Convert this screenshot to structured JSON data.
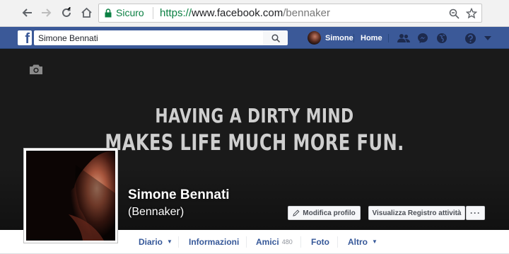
{
  "browser": {
    "secure_label": "Sicuro",
    "url_scheme": "https://",
    "url_host": "www.facebook.com",
    "url_path": "/bennaker"
  },
  "fb_bar": {
    "logo": "f",
    "search_value": "Simone Bennati",
    "user_name": "Simone",
    "home_label": "Home"
  },
  "cover": {
    "quote_line1": "HAVING A DIRTY MIND",
    "quote_line2": "MAKES LIFE MUCH MORE FUN."
  },
  "profile": {
    "name": "Simone Bennati",
    "alternate_name": "(Bennaker)"
  },
  "actions": {
    "edit_profile": "Modifica profilo",
    "activity_log": "Visualizza Registro attività",
    "more": "···"
  },
  "tabs": {
    "timeline": "Diario",
    "about": "Informazioni",
    "friends": "Amici",
    "friends_count": "480",
    "photos": "Foto",
    "more": "Altro"
  },
  "colors": {
    "fb_blue": "#3b5998",
    "link_blue": "#365899",
    "secure_green": "#0b8043"
  }
}
